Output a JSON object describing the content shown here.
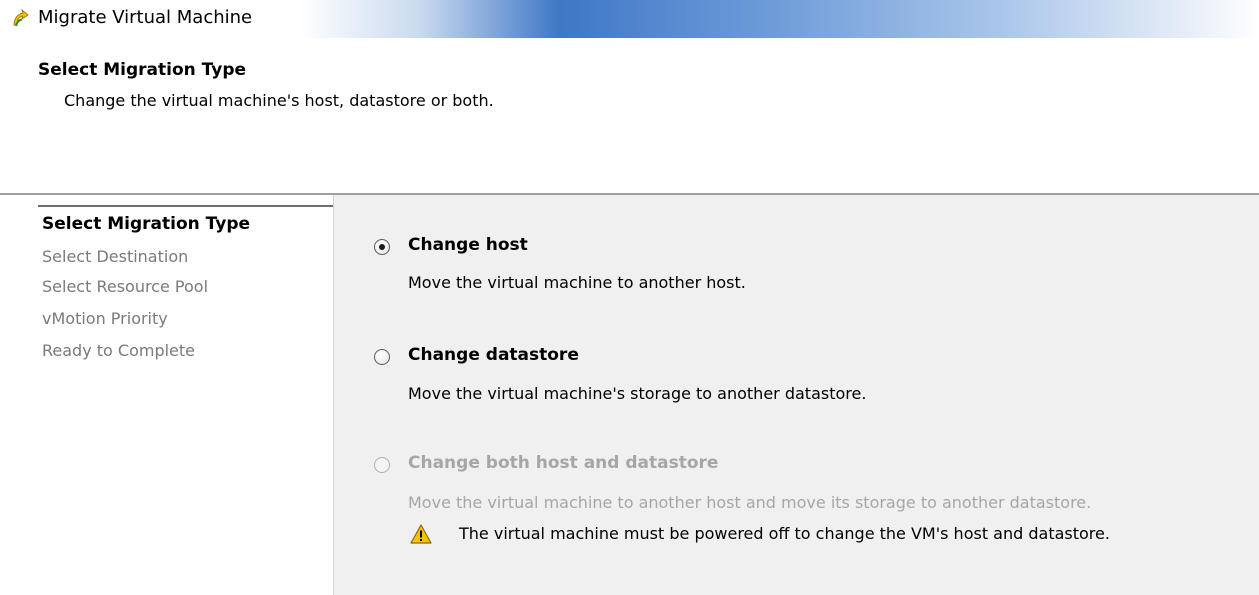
{
  "window": {
    "title": "Migrate Virtual Machine",
    "icon": "vm-migrate-icon"
  },
  "header": {
    "title": "Select Migration Type",
    "subtitle": "Change the virtual machine's host, datastore or both."
  },
  "sidebar": {
    "items": [
      {
        "label": "Select Migration Type",
        "active": true
      },
      {
        "label": "Select Destination",
        "active": false
      },
      {
        "label": "Select Resource Pool",
        "active": false
      },
      {
        "label": "vMotion Priority",
        "active": false
      },
      {
        "label": "Ready to Complete",
        "active": false
      }
    ]
  },
  "options": [
    {
      "label": "Change host",
      "description": "Move the virtual machine to another host.",
      "selected": true,
      "enabled": true
    },
    {
      "label": "Change datastore",
      "description": "Move the virtual machine's storage to another datastore.",
      "selected": false,
      "enabled": true
    },
    {
      "label": "Change both host and datastore",
      "description": "Move the virtual machine to another host and move its storage to another datastore.",
      "selected": false,
      "enabled": false
    }
  ],
  "warning": {
    "icon": "warning-icon",
    "text": "The virtual machine must be powered off to change the VM's host and datastore."
  },
  "colors": {
    "titlebar_accent": "#3f77c6",
    "warning_yellow": "#f5c400",
    "disabled_text": "#a6a6a6",
    "panel_background": "#f0f0f0"
  }
}
